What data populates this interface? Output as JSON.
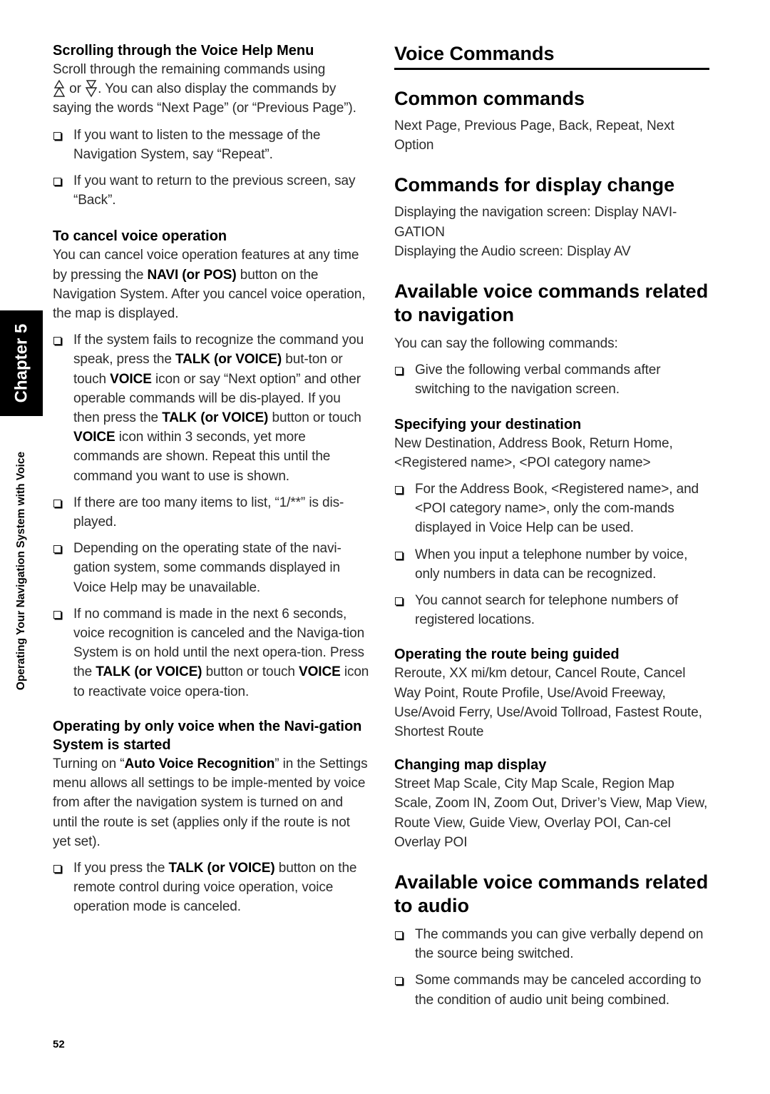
{
  "sidebar": {
    "chapter_label": "Chapter 5",
    "section_title": "Operating Your Navigation System with Voice"
  },
  "page_number": "52",
  "left": {
    "scrolling": {
      "heading": "Scrolling through the Voice Help Menu",
      "p1_a": "Scroll through the remaining commands using",
      "up_icon": "scroll-up-icon",
      "or": " or ",
      "down_icon": "scroll-down-icon",
      "p1_b": ". You can also display the commands by saying the words “Next Page” (or “Previous Page”).",
      "notes": [
        "If you want to listen to the message of the Navigation System, say “Repeat”.",
        "If you want to return to the previous screen, say “Back”."
      ]
    },
    "cancel": {
      "heading": "To cancel voice operation",
      "p_a": "You can cancel voice operation features at any time by pressing the ",
      "p_b": "NAVI (or POS)",
      "p_c": " button on the Navigation System. After you cancel voice operation, the map is displayed.",
      "note1": {
        "a": "If the system fails to recognize the command you speak, press the ",
        "b": "TALK (or VOICE)",
        "c": " but-ton or touch ",
        "d": "VOICE",
        "e": " icon or say “Next option” and other operable commands will be dis-played. If you then press the ",
        "f": "TALK (or VOICE)",
        "g": " button or touch ",
        "h": "VOICE",
        "i": " icon within 3 seconds, yet more commands are shown. Repeat this until the command you want to use is shown."
      },
      "note2": "If there are too many items to list, “1/**” is dis-played.",
      "note3": "Depending on the operating state of the navi-gation system, some commands displayed in Voice Help may be unavailable.",
      "note4": {
        "a": "If no command is made in the next 6 seconds, voice recognition is canceled and the Naviga-tion System is on hold until the next opera-tion. Press the ",
        "b": "TALK (or VOICE)",
        "c": " button or touch ",
        "d": "VOICE",
        "e": " icon to reactivate voice opera-tion."
      }
    },
    "auto": {
      "heading": "Operating by only voice when the Navi-gation System is started",
      "p_a": "Turning on “",
      "p_b": "Auto Voice Recognition",
      "p_c": "” in the Settings menu allows all settings to be imple-mented by voice from after the navigation system is turned on and until the route is set (applies only if the route is not yet set).",
      "note": {
        "a": "If you press the ",
        "b": "TALK (or VOICE)",
        "c": " button on the remote control during voice operation, voice operation mode is canceled."
      }
    }
  },
  "right": {
    "title": "Voice Commands",
    "common": {
      "heading": "Common commands",
      "text": "Next Page, Previous Page, Back, Repeat, Next Option"
    },
    "display_change": {
      "heading": "Commands for display change",
      "line1": "Displaying the navigation screen: Display NAVI-GATION",
      "line2": "Displaying the Audio screen: Display AV"
    },
    "navigation": {
      "heading": "Available voice commands related to navigation",
      "intro": "You can say the following commands:",
      "note": "Give the following verbal commands after switching to the navigation screen.",
      "destination": {
        "heading": "Specifying your destination",
        "text": "New Destination, Address Book, Return Home, <Registered name>, <POI category name>",
        "notes": [
          "For the Address Book, <Registered name>, and <POI category name>, only the com-mands displayed in Voice Help can be used.",
          "When you input a telephone number by voice, only numbers in data can be recognized.",
          "You cannot search for telephone numbers of registered locations."
        ]
      },
      "route": {
        "heading": "Operating the route being guided",
        "text": "Reroute, XX mi/km detour, Cancel Route, Cancel Way Point, Route Profile, Use/Avoid Freeway, Use/Avoid Ferry, Use/Avoid Tollroad, Fastest Route, Shortest Route"
      },
      "map": {
        "heading": "Changing map display",
        "text": "Street Map Scale, City Map Scale, Region Map Scale, Zoom IN, Zoom Out, Driver’s View, Map View, Route View, Guide View, Overlay POI, Can-cel Overlay POI"
      }
    },
    "audio": {
      "heading": "Available voice commands related to audio",
      "notes": [
        "The commands you can give verbally depend on the source being switched.",
        "Some commands may be canceled according to the condition of audio unit being combined."
      ]
    }
  }
}
